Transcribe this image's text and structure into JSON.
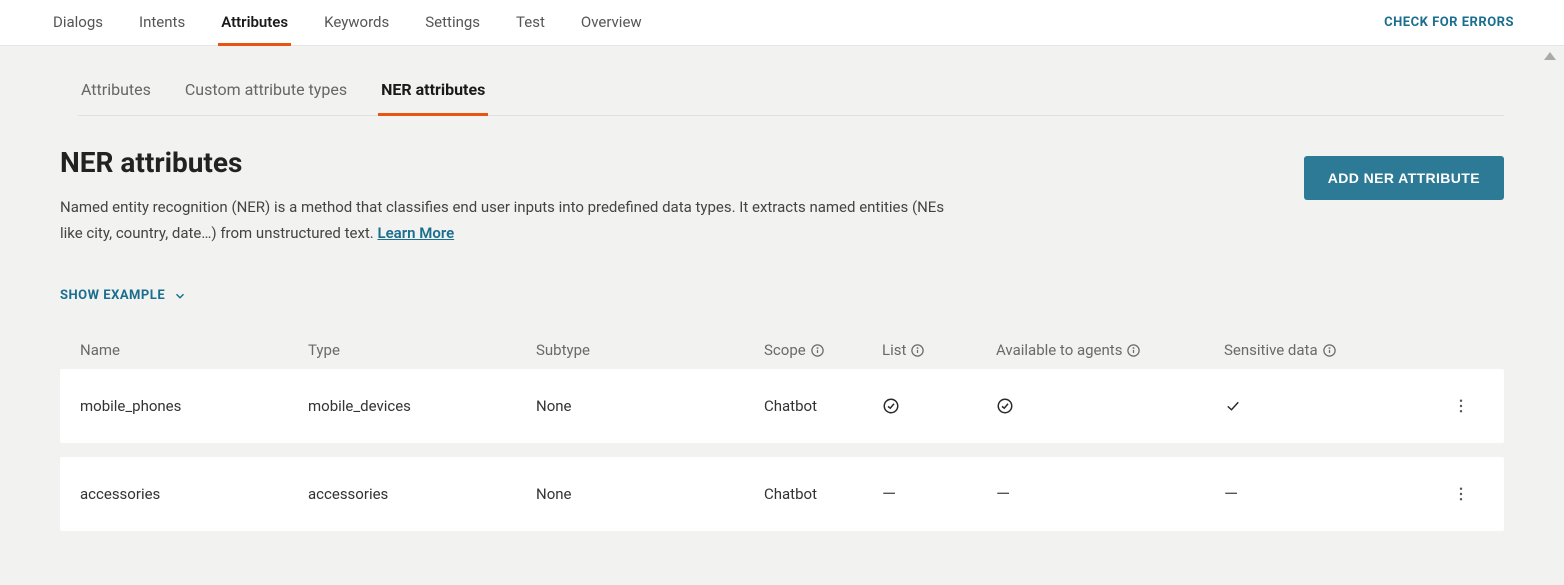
{
  "topNav": {
    "tabs": [
      {
        "label": "Dialogs",
        "active": false
      },
      {
        "label": "Intents",
        "active": false
      },
      {
        "label": "Attributes",
        "active": true
      },
      {
        "label": "Keywords",
        "active": false
      },
      {
        "label": "Settings",
        "active": false
      },
      {
        "label": "Test",
        "active": false
      },
      {
        "label": "Overview",
        "active": false
      }
    ],
    "checkErrors": "CHECK FOR ERRORS"
  },
  "subTabs": [
    {
      "label": "Attributes",
      "active": false
    },
    {
      "label": "Custom attribute types",
      "active": false
    },
    {
      "label": "NER attributes",
      "active": true
    }
  ],
  "page": {
    "title": "NER attributes",
    "description": "Named entity recognition (NER) is a method that classifies end user inputs into predefined data types. It extracts named entities (NEs like city, country, date…) from unstructured text. ",
    "learnMore": "Learn More",
    "addButton": "ADD NER ATTRIBUTE",
    "showExample": "SHOW EXAMPLE"
  },
  "table": {
    "headers": {
      "name": "Name",
      "type": "Type",
      "subtype": "Subtype",
      "scope": "Scope",
      "list": "List",
      "agents": "Available to agents",
      "sensitive": "Sensitive data"
    },
    "rows": [
      {
        "name": "mobile_phones",
        "type": "mobile_devices",
        "subtype": "None",
        "scope": "Chatbot",
        "list": "check-circle",
        "agents": "check-circle",
        "sensitive": "check-plain"
      },
      {
        "name": "accessories",
        "type": "accessories",
        "subtype": "None",
        "scope": "Chatbot",
        "list": "dash",
        "agents": "dash",
        "sensitive": "dash"
      }
    ]
  }
}
